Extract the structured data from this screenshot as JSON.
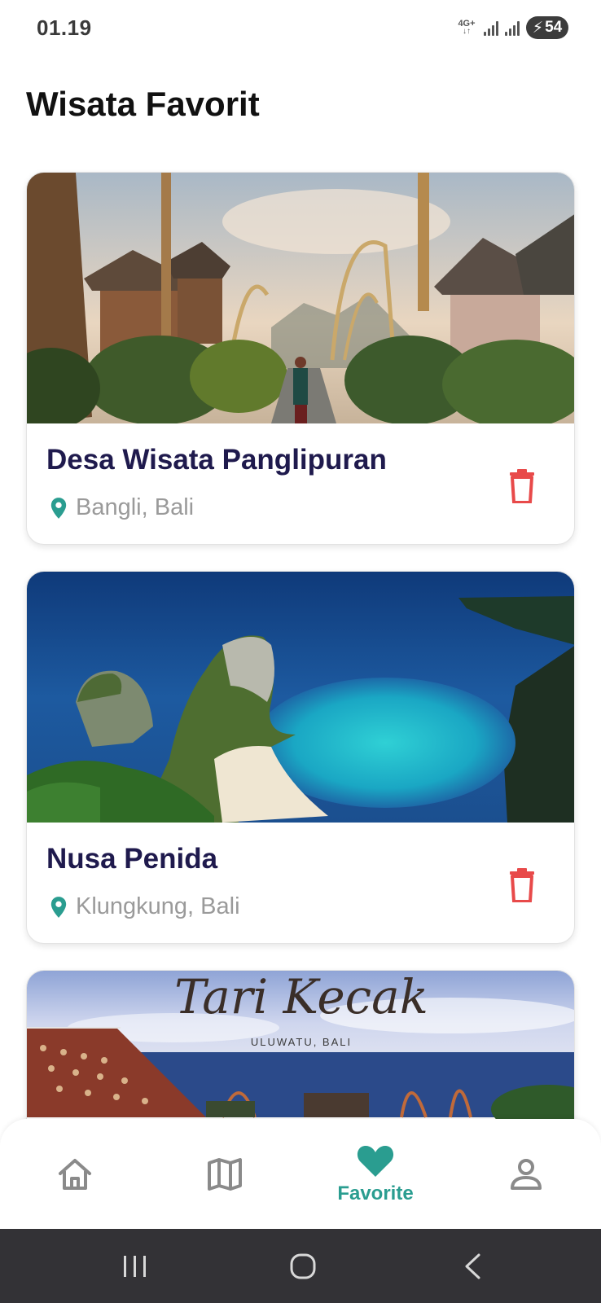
{
  "status_bar": {
    "time": "01.19",
    "network": "4G+",
    "battery": "54"
  },
  "page": {
    "title": "Wisata Favorit"
  },
  "favorites": [
    {
      "name": "Desa Wisata Panglipuran",
      "location": "Bangli, Bali"
    },
    {
      "name": "Nusa Penida",
      "location": "Klungkung, Bali"
    },
    {
      "image_caption_title": "Tari Kecak",
      "image_caption_subtitle": "ULUWATU, BALI"
    }
  ],
  "icons": {
    "location": "location-pin-icon",
    "delete": "trash-icon",
    "home": "home-icon",
    "map": "map-icon",
    "favorite": "heart-icon",
    "profile": "person-icon"
  },
  "bottom_nav": {
    "items": [
      {
        "key": "home",
        "label": ""
      },
      {
        "key": "map",
        "label": ""
      },
      {
        "key": "favorite",
        "label": "Favorite",
        "active": true
      },
      {
        "key": "profile",
        "label": ""
      }
    ]
  },
  "colors": {
    "accent": "#2a9d90",
    "title": "#1f1a4d",
    "delete": "#e84a4a",
    "muted": "#9a9a9a"
  }
}
